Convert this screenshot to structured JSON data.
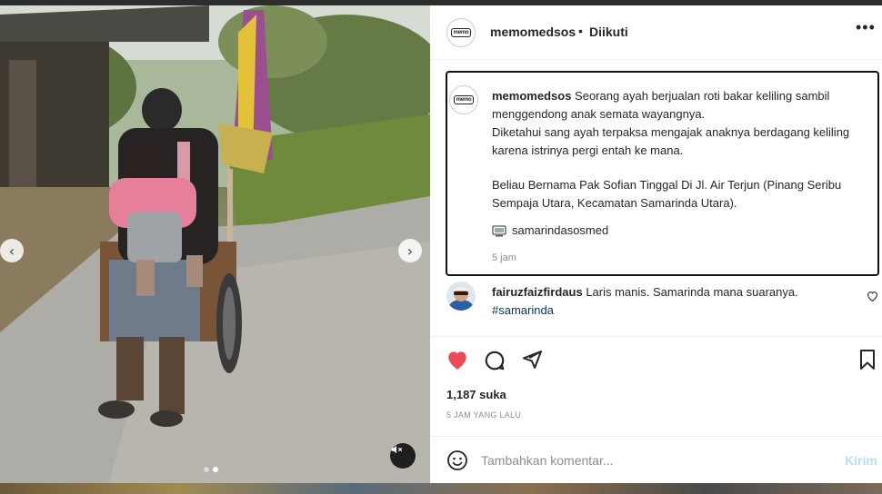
{
  "media": {
    "nav_prev_label": "‹",
    "nav_next_label": "›",
    "slide_count": 2,
    "active_slide": 2,
    "mute_icon": "speaker-muted-icon"
  },
  "header": {
    "username": "memomedsos",
    "separator": "•",
    "follow_status": "Diikuti",
    "more_label": "•••"
  },
  "avatar": {
    "logo_text": "memo"
  },
  "caption": {
    "username": "memomedsos",
    "line1": "Seorang ayah berjualan roti bakar keliling sambil menggendong anak semata wayangnya.",
    "line2": "Diketahui sang ayah terpaksa mengajak anaknya berdagang keliling karena istrinya pergi entah ke mana.",
    "line3": "Beliau Bernama Pak Sofian Tinggal Di Jl. Air Terjun (Pinang Seribu Sempaja Utara, Kecamatan Samarinda Utara).",
    "source": "samarindasosmed",
    "time": "5 jam"
  },
  "comment": {
    "username": "fairuzfaizfirdaus",
    "text": "Laris manis. Samarinda mana suaranya.",
    "hashtag": "#samarinda"
  },
  "post": {
    "likes": "1,187 suka",
    "time_ago": "5 JAM YANG LALU"
  },
  "comment_bar": {
    "placeholder": "Tambahkan komentar...",
    "post_label": "Kirim"
  },
  "colors": {
    "like_red": "#ed4956",
    "post_disabled": "#b2dffc",
    "hashtag": "#00376b"
  }
}
